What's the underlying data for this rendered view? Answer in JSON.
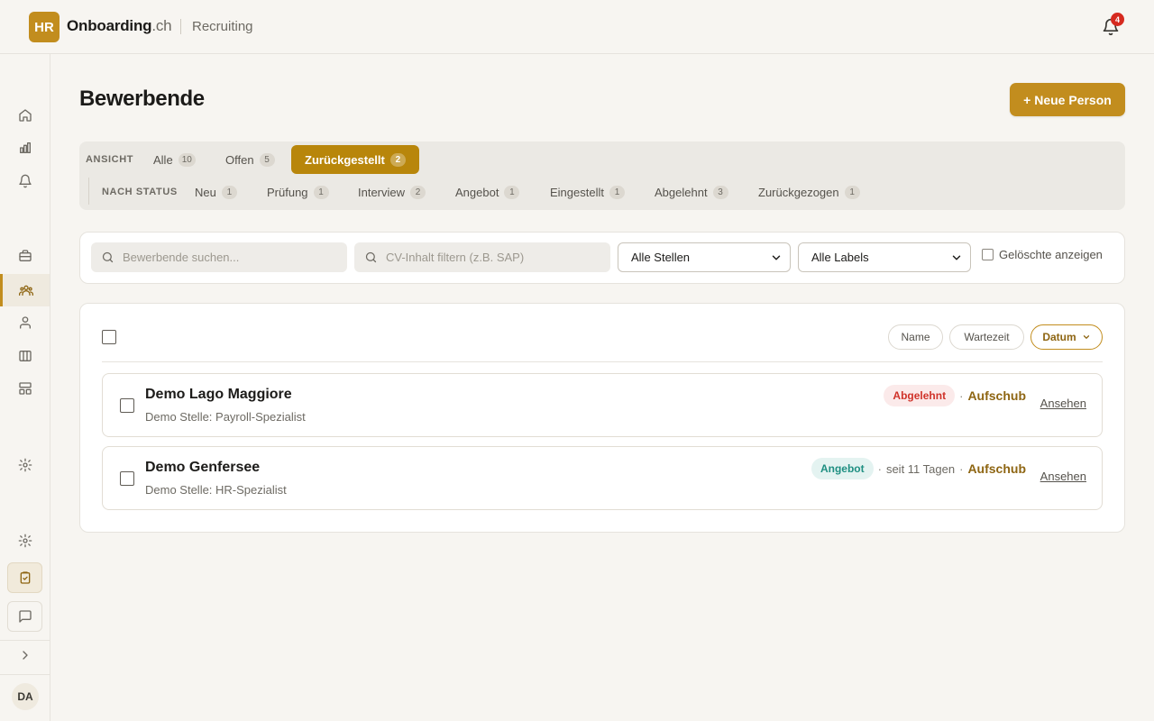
{
  "header": {
    "logo": "HR",
    "brand_name": "Onboarding",
    "brand_tld": ".ch",
    "module": "Recruiting",
    "notification_count": "4"
  },
  "sidebar": {
    "avatar": "DA",
    "icons": [
      "home-icon",
      "chart-icon",
      "bell-icon",
      "briefcase-icon",
      "users-icon",
      "user-group-icon",
      "board-icon",
      "layout-icon",
      "gear-icon",
      "settings-icon",
      "clipboard-icon",
      "chat-icon",
      "chevron-right-icon"
    ]
  },
  "page": {
    "title": "Bewerbende",
    "new_button": "+ Neue Person"
  },
  "filters": {
    "view_label": "ANSICHT",
    "views": [
      {
        "label": "Alle",
        "count": "10"
      },
      {
        "label": "Offen",
        "count": "5"
      },
      {
        "label": "Zurückgestellt",
        "count": "2"
      }
    ],
    "status_label": "NACH STATUS",
    "statuses": [
      {
        "label": "Neu",
        "count": "1"
      },
      {
        "label": "Prüfung",
        "count": "1"
      },
      {
        "label": "Interview",
        "count": "2"
      },
      {
        "label": "Angebot",
        "count": "1"
      },
      {
        "label": "Eingestellt",
        "count": "1"
      },
      {
        "label": "Abgelehnt",
        "count": "3"
      },
      {
        "label": "Zurückgezogen",
        "count": "1"
      }
    ]
  },
  "search": {
    "name_placeholder": "Bewerbende suchen...",
    "cv_placeholder": "CV-Inhalt filtern (z.B. SAP)",
    "jobs_select": "Alle Stellen",
    "labels_select": "Alle Labels",
    "show_deleted": "Gelöschte anzeigen"
  },
  "sort": {
    "name": "Name",
    "wait": "Wartezeit",
    "date": "Datum"
  },
  "candidates": [
    {
      "name": "Demo Lago Maggiore",
      "position": "Demo Stelle: Payroll-Spezialist",
      "status": "Abgelehnt",
      "waiting": "",
      "defer": "Aufschub",
      "view": "Ansehen"
    },
    {
      "name": "Demo Genfersee",
      "position": "Demo Stelle: HR-Spezialist",
      "status": "Angebot",
      "waiting": "seit 11 Tagen",
      "defer": "Aufschub",
      "view": "Ansehen"
    }
  ],
  "colors": {
    "accent": "#c28d1e",
    "active_tab": "#b8860b",
    "rejected": "#d0332a",
    "offer": "#1f8f82"
  }
}
